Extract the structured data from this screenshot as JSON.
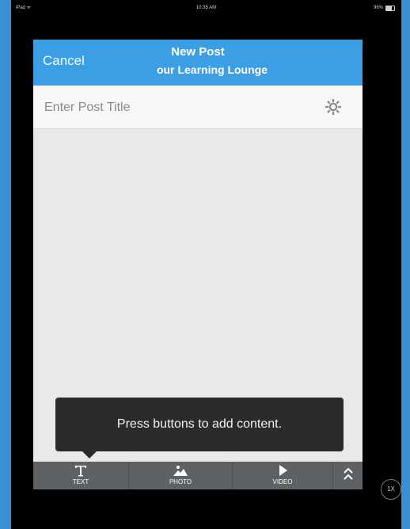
{
  "status_bar": {
    "carrier": "iPad ᯤ",
    "time": "10:35 AM",
    "battery": "96%"
  },
  "nav": {
    "cancel_label": "Cancel",
    "title": "New Post",
    "subtitle": "our Learning Lounge"
  },
  "post_title_input": {
    "placeholder": "Enter Post Title",
    "value": ""
  },
  "tooltip": {
    "text": "Press buttons to add content."
  },
  "toolbar": {
    "text_label": "TEXT",
    "photo_label": "PHOTO",
    "video_label": "VIDEO"
  },
  "zoom_badge": "1X",
  "colors": {
    "nav_blue": "#3c9ee5",
    "toolbar_gray": "#5f6264",
    "tooltip_dark": "#2b2b2b"
  }
}
